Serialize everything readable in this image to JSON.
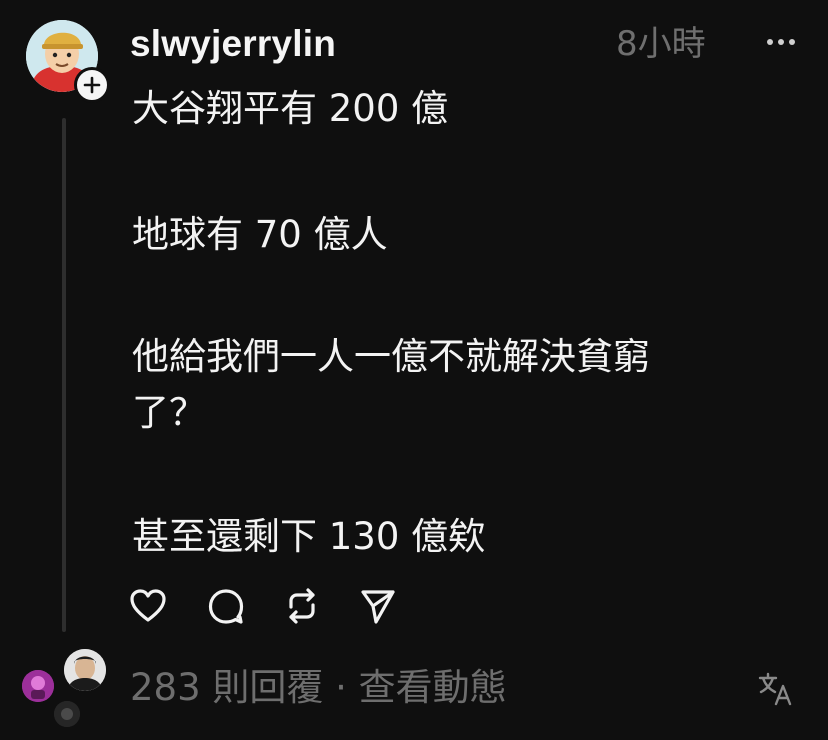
{
  "post": {
    "username": "slwyjerrylin",
    "timestamp": "8小時",
    "lines": [
      "大谷翔平有 200 億",
      "地球有 70 億人",
      "他給我們一人一億不就解決貧窮",
      "了？",
      "甚至還剩下 130 億欸"
    ]
  },
  "footer": {
    "replies_text": "283 則回覆 · 查看動態"
  },
  "icons": {
    "more": "more-icon",
    "follow": "plus-icon",
    "like": "heart-icon",
    "comment": "comment-icon",
    "repost": "repost-icon",
    "share": "send-icon",
    "translate": "translate-icon"
  },
  "colors": {
    "background": "#0f0f0f",
    "text": "#f3f3f3",
    "muted": "#6e6e6e",
    "thread_line": "#2e2e2e"
  }
}
